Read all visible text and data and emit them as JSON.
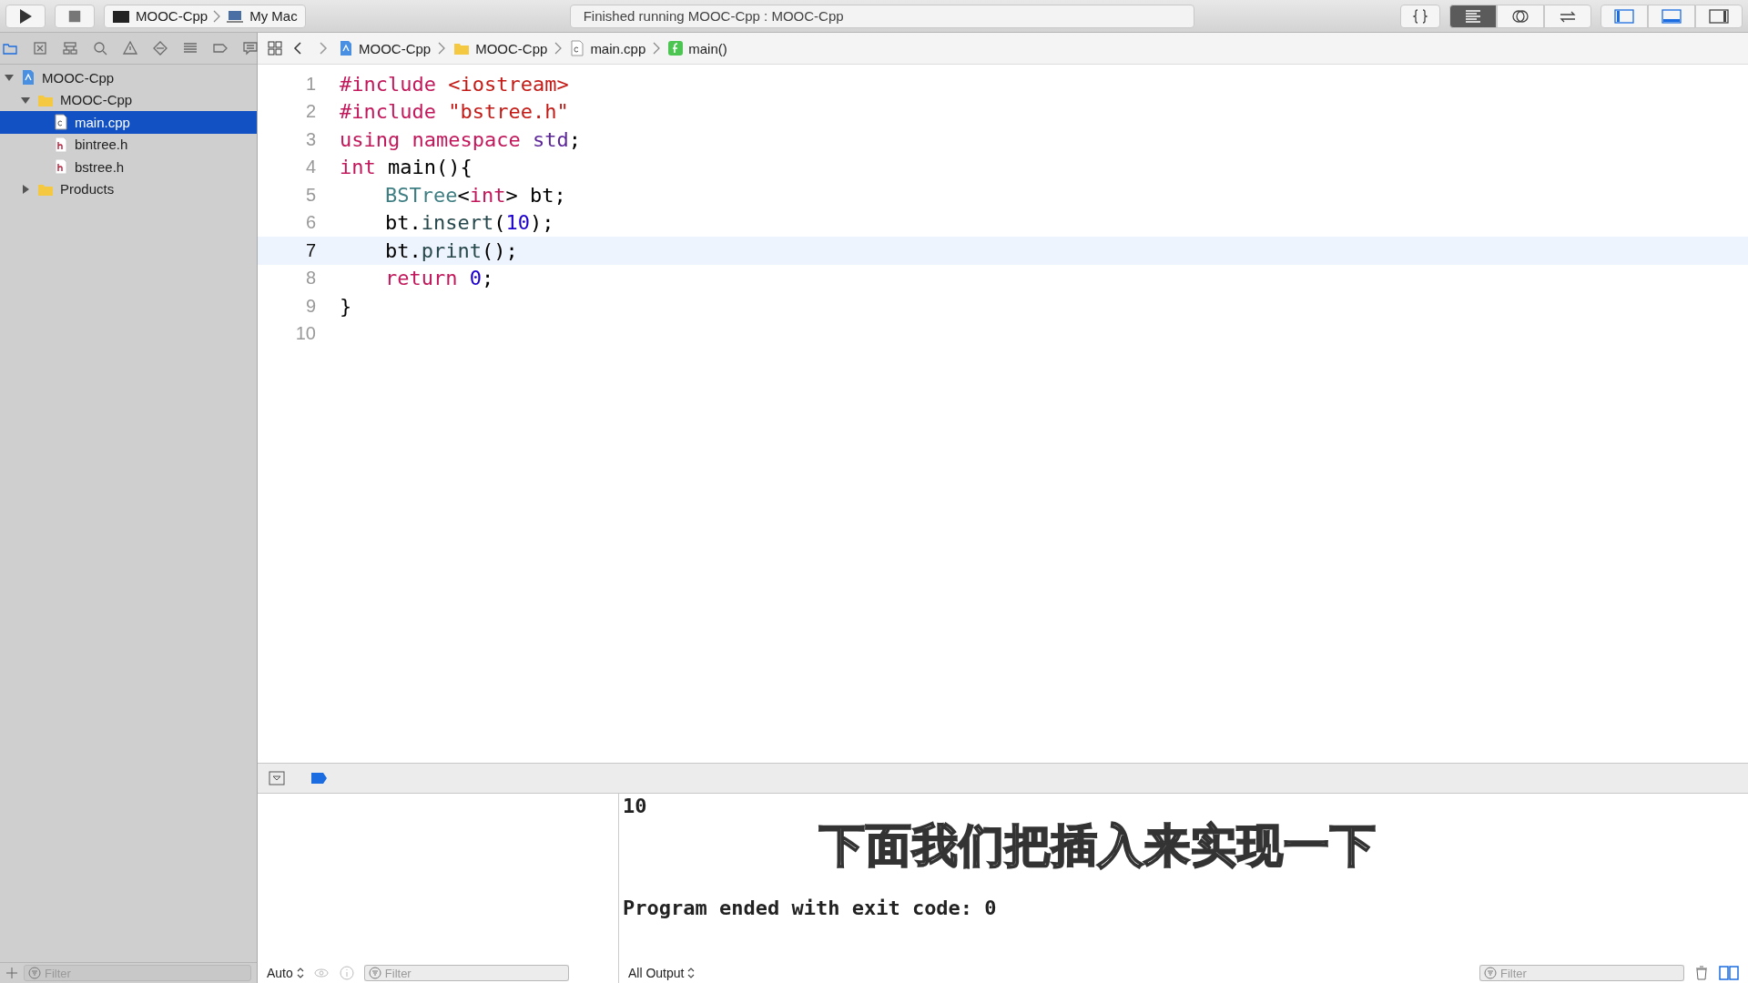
{
  "toolbar": {
    "scheme": {
      "target": "MOOC-Cpp",
      "destination": "My Mac"
    },
    "activity": "Finished running MOOC-Cpp : MOOC-Cpp",
    "editor_modes": [
      {
        "kind": "standard",
        "selected": true
      },
      {
        "kind": "assistant",
        "selected": false
      },
      {
        "kind": "version",
        "selected": false
      }
    ],
    "panels": [
      {
        "kind": "left",
        "on": true
      },
      {
        "kind": "bottom",
        "on": true
      },
      {
        "kind": "right",
        "on": false
      }
    ]
  },
  "navigator": {
    "tabs": [
      {
        "kind": "project",
        "selected": true
      },
      {
        "kind": "symbol",
        "selected": false
      },
      {
        "kind": "hierarchy",
        "selected": false
      },
      {
        "kind": "find",
        "selected": false
      },
      {
        "kind": "issue",
        "selected": false
      },
      {
        "kind": "test",
        "selected": false
      },
      {
        "kind": "debug",
        "selected": false
      },
      {
        "kind": "breakpoint",
        "selected": false
      },
      {
        "kind": "report",
        "selected": false
      }
    ],
    "tree": [
      {
        "label": "MOOC-Cpp",
        "kind": "project",
        "expanded": true,
        "selected": false,
        "children": [
          {
            "label": "MOOC-Cpp",
            "kind": "folder",
            "expanded": true,
            "selected": false,
            "children": [
              {
                "label": "main.cpp",
                "kind": "source",
                "selected": true
              },
              {
                "label": "bintree.h",
                "kind": "header",
                "selected": false
              },
              {
                "label": "bstree.h",
                "kind": "header",
                "selected": false
              }
            ]
          },
          {
            "label": "Products",
            "kind": "folder",
            "expanded": false,
            "selected": false
          }
        ]
      }
    ],
    "filter": {
      "placeholder": "Filter"
    }
  },
  "jump_bar": [
    {
      "label": "MOOC-Cpp",
      "kind": "project"
    },
    {
      "label": "MOOC-Cpp",
      "kind": "folder"
    },
    {
      "label": "main.cpp",
      "kind": "source"
    },
    {
      "label": "main()",
      "kind": "function"
    }
  ],
  "code": [
    {
      "number": "1",
      "selected": false,
      "indented": false,
      "tokens": [
        {
          "text": "#include ",
          "kind": "keyword"
        },
        {
          "text": "<iostream>",
          "kind": "string"
        }
      ]
    },
    {
      "number": "2",
      "selected": false,
      "indented": false,
      "tokens": [
        {
          "text": "#include ",
          "kind": "keyword"
        },
        {
          "text": "\"bstree.h\"",
          "kind": "string"
        }
      ]
    },
    {
      "number": "3",
      "selected": false,
      "indented": false,
      "tokens": [
        {
          "text": "using namespace ",
          "kind": "keyword"
        },
        {
          "text": "std",
          "kind": "ident"
        },
        {
          "text": ";",
          "kind": "plain"
        }
      ]
    },
    {
      "number": "4",
      "selected": false,
      "indented": false,
      "tokens": [
        {
          "text": "int",
          "kind": "keyword"
        },
        {
          "text": " main(){",
          "kind": "plain"
        }
      ]
    },
    {
      "number": "5",
      "selected": false,
      "indented": true,
      "tokens": [
        {
          "text": "BSTree",
          "kind": "type"
        },
        {
          "text": "<",
          "kind": "plain"
        },
        {
          "text": "int",
          "kind": "keyword"
        },
        {
          "text": "> bt;",
          "kind": "plain"
        }
      ]
    },
    {
      "number": "6",
      "selected": false,
      "indented": true,
      "tokens": [
        {
          "text": "bt.",
          "kind": "plain"
        },
        {
          "text": "insert",
          "kind": "method"
        },
        {
          "text": "(",
          "kind": "plain"
        },
        {
          "text": "10",
          "kind": "number"
        },
        {
          "text": ");",
          "kind": "plain"
        }
      ]
    },
    {
      "number": "7",
      "selected": true,
      "indented": true,
      "tokens": [
        {
          "text": "bt.",
          "kind": "plain"
        },
        {
          "text": "print",
          "kind": "method"
        },
        {
          "text": "();",
          "kind": "plain"
        }
      ]
    },
    {
      "number": "8",
      "selected": false,
      "indented": true,
      "tokens": [
        {
          "text": "return ",
          "kind": "keyword"
        },
        {
          "text": "0",
          "kind": "number"
        },
        {
          "text": ";",
          "kind": "plain"
        }
      ]
    },
    {
      "number": "9",
      "selected": false,
      "indented": false,
      "tokens": [
        {
          "text": "}",
          "kind": "plain"
        }
      ]
    },
    {
      "number": "10",
      "selected": false
    }
  ],
  "debug_bar": {
    "breakpoints_active": true
  },
  "variables": {
    "scope": "Auto",
    "filter": {
      "placeholder": "Filter"
    }
  },
  "console": {
    "lines": [
      "10",
      "Program ended with exit code: 0"
    ],
    "output": "All Output",
    "filter": {
      "placeholder": "Filter"
    }
  },
  "subtitle": "下面我们把插入来实现一下"
}
